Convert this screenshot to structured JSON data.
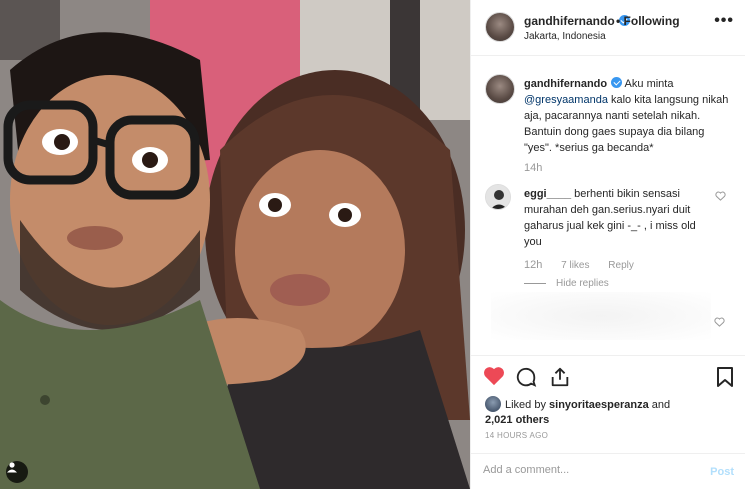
{
  "header": {
    "username": "gandhifernando",
    "follow_status": "• Following",
    "location": "Jakarta, Indonesia",
    "more_glyph": "•••"
  },
  "caption": {
    "username": "gandhifernando",
    "text_before": " Aku minta ",
    "mention": "@gresyaamanda",
    "text_after": " kalo kita langsung nikah aja, pacarannya nanti setelah nikah. Bantuin dong gaes supaya dia bilang \"yes\". *serius ga becanda*",
    "time": "14h"
  },
  "comment": {
    "username": "eggi____",
    "text": " berhenti bikin sensasi murahan deh gan.serius.nyari duit gaharus jual kek gini -_- , i miss old you",
    "time": "12h",
    "likes": "7 likes",
    "reply": "Reply",
    "hide_replies": "Hide replies"
  },
  "likes": {
    "prefix": "Liked by ",
    "user": "sinyoritaesperanza",
    "and": " and",
    "others": "2,021 others"
  },
  "timestamp": "14 HOURS AGO",
  "add_comment": {
    "placeholder": "Add a comment...",
    "post_label": "Post"
  },
  "icons": {
    "like": "heart-icon",
    "comment": "comment-icon",
    "share": "share-icon",
    "save": "bookmark-icon",
    "liked_color": "#ed4956",
    "verified_color": "#3897f0"
  }
}
